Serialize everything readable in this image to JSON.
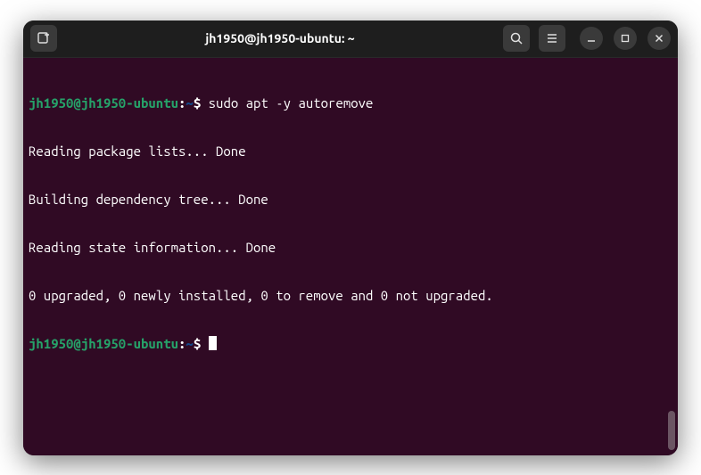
{
  "titlebar": {
    "title": "jh1950@jh1950-ubuntu: ~"
  },
  "terminal": {
    "prompt": {
      "user_host": "jh1950@jh1950-ubuntu",
      "colon": ":",
      "path": "~",
      "dollar": "$"
    },
    "lines": [
      {
        "type": "prompt",
        "command": "sudo apt -y autoremove"
      },
      {
        "type": "output",
        "text": "Reading package lists... Done"
      },
      {
        "type": "output",
        "text": "Building dependency tree... Done"
      },
      {
        "type": "output",
        "text": "Reading state information... Done"
      },
      {
        "type": "output",
        "text": "0 upgraded, 0 newly installed, 0 to remove and 0 not upgraded."
      },
      {
        "type": "prompt",
        "command": ""
      }
    ]
  },
  "colors": {
    "terminal_bg": "#300a24",
    "prompt_green": "#26a269",
    "prompt_blue": "#12488b",
    "text_white": "#ffffff"
  }
}
